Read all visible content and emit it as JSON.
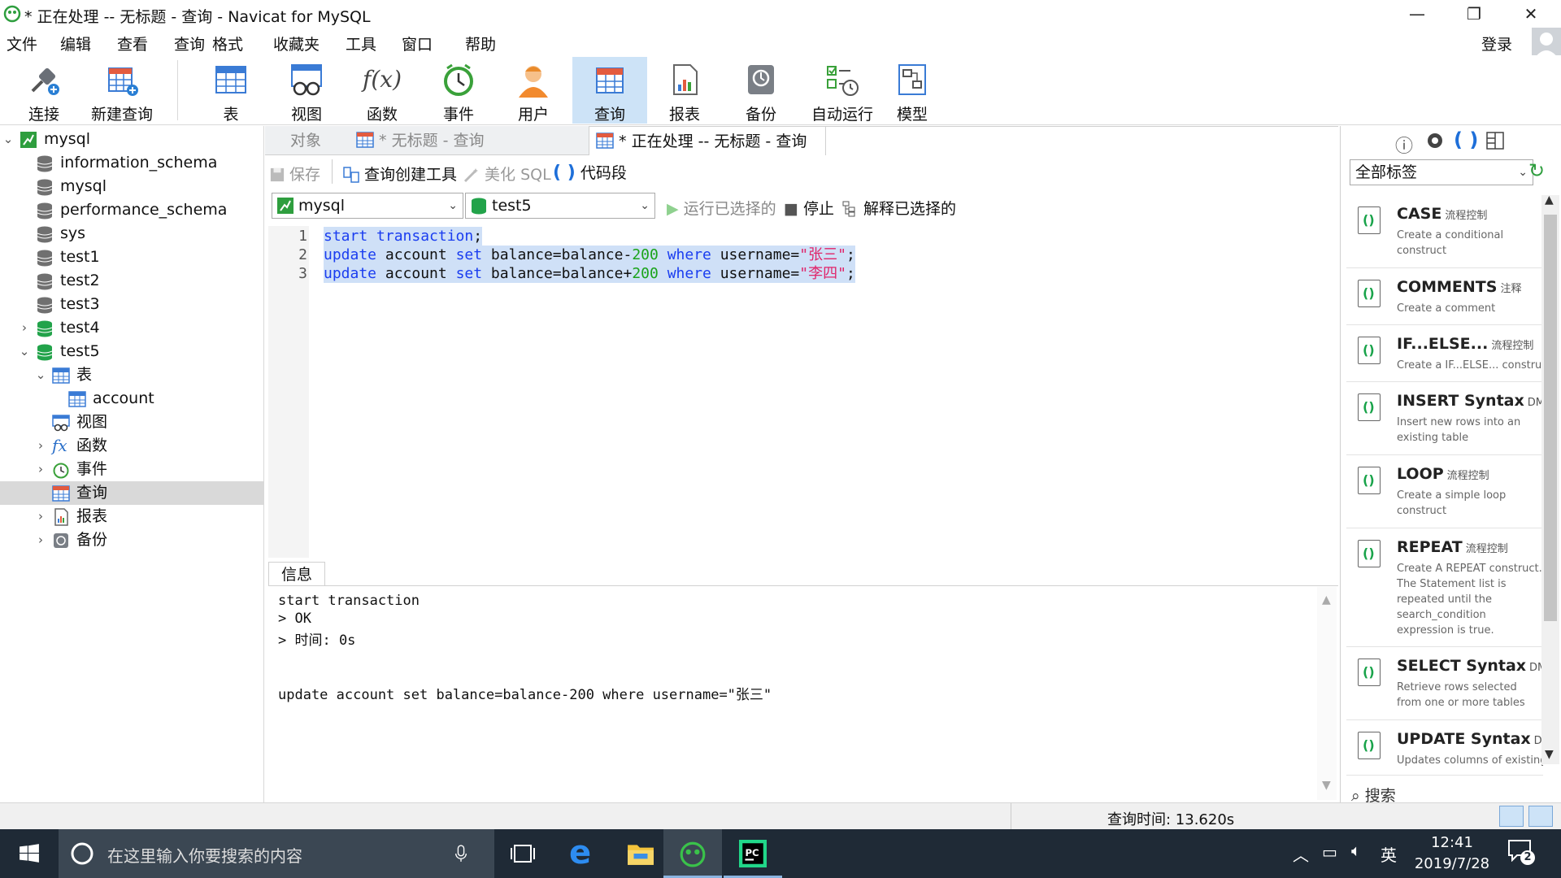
{
  "window": {
    "title": "* 正在处理 -- 无标题 - 查询 - Navicat for MySQL",
    "minimize": "—",
    "maximize": "❐",
    "close": "✕"
  },
  "menu": {
    "items": [
      "文件",
      "编辑",
      "查看",
      "查询",
      "格式",
      "收藏夹",
      "工具",
      "窗口",
      "帮助"
    ],
    "login": "登录"
  },
  "toolbar": {
    "items": [
      {
        "label": "连接",
        "icon": "connection-icon"
      },
      {
        "label": "新建查询",
        "icon": "new-query-icon"
      },
      {
        "label": "表",
        "icon": "table-icon"
      },
      {
        "label": "视图",
        "icon": "view-icon"
      },
      {
        "label": "函数",
        "icon": "function-icon"
      },
      {
        "label": "事件",
        "icon": "event-clock-icon"
      },
      {
        "label": "用户",
        "icon": "user-icon"
      },
      {
        "label": "查询",
        "icon": "query-icon"
      },
      {
        "label": "报表",
        "icon": "report-icon"
      },
      {
        "label": "备份",
        "icon": "backup-icon"
      },
      {
        "label": "自动运行",
        "icon": "autorun-icon"
      },
      {
        "label": "模型",
        "icon": "model-icon"
      }
    ],
    "function_glyph": "f(x)",
    "accent": "#cde3f7"
  },
  "tree": [
    {
      "label": "mysql",
      "level": 0,
      "expanded": true,
      "icon": "connection-icon"
    },
    {
      "label": "information_schema",
      "level": 1,
      "icon": "database-icon"
    },
    {
      "label": "mysql",
      "level": 1,
      "icon": "database-icon"
    },
    {
      "label": "performance_schema",
      "level": 1,
      "icon": "database-icon"
    },
    {
      "label": "sys",
      "level": 1,
      "icon": "database-icon"
    },
    {
      "label": "test1",
      "level": 1,
      "icon": "database-icon"
    },
    {
      "label": "test2",
      "level": 1,
      "icon": "database-icon"
    },
    {
      "label": "test3",
      "level": 1,
      "icon": "database-icon"
    },
    {
      "label": "test4",
      "level": 1,
      "icon": "database-green-icon",
      "collapsed": true
    },
    {
      "label": "test5",
      "level": 1,
      "icon": "database-green-icon",
      "expanded": true
    },
    {
      "label": "表",
      "level": 2,
      "icon": "table-icon",
      "expanded": true
    },
    {
      "label": "account",
      "level": 3,
      "icon": "table-icon"
    },
    {
      "label": "视图",
      "level": 2,
      "icon": "view-icon"
    },
    {
      "label": "函数",
      "level": 2,
      "icon": "function-icon",
      "collapsed": true
    },
    {
      "label": "事件",
      "level": 2,
      "icon": "event-clock-icon",
      "collapsed": true
    },
    {
      "label": "查询",
      "level": 2,
      "icon": "query-icon",
      "selected": true
    },
    {
      "label": "报表",
      "level": 2,
      "icon": "report-icon",
      "collapsed": true
    },
    {
      "label": "备份",
      "level": 2,
      "icon": "backup-icon",
      "collapsed": true
    }
  ],
  "tabs": [
    {
      "label": "对象"
    },
    {
      "label": "* 无标题 - 查询"
    },
    {
      "label": "* 正在处理 -- 无标题 - 查询",
      "active": true
    }
  ],
  "subtoolbar": {
    "save": "保存",
    "query_builder": "查询创建工具",
    "beautify": "美化 SQL",
    "snippet": "代码段"
  },
  "dbbar": {
    "connection": "mysql",
    "database": "test5",
    "run_selected": "运行已选择的",
    "stop": "停止",
    "explain": "解释已选择的"
  },
  "editor": {
    "line_numbers": [
      "1",
      "2",
      "3"
    ],
    "lines": [
      [
        {
          "t": "start transaction",
          "c": "kw"
        },
        {
          "t": ";",
          "c": ""
        }
      ],
      [
        {
          "t": "update",
          "c": "kw"
        },
        {
          "t": " account ",
          "c": ""
        },
        {
          "t": "set",
          "c": "kw"
        },
        {
          "t": " balance=balance-",
          "c": ""
        },
        {
          "t": "200",
          "c": "num"
        },
        {
          "t": " ",
          "c": ""
        },
        {
          "t": "where",
          "c": "kw"
        },
        {
          "t": " username=",
          "c": ""
        },
        {
          "t": "\"张三\"",
          "c": "str"
        },
        {
          "t": ";",
          "c": ""
        }
      ],
      [
        {
          "t": "update",
          "c": "kw"
        },
        {
          "t": " account ",
          "c": ""
        },
        {
          "t": "set",
          "c": "kw"
        },
        {
          "t": " balance=balance+",
          "c": ""
        },
        {
          "t": "200",
          "c": "num"
        },
        {
          "t": " ",
          "c": ""
        },
        {
          "t": "where",
          "c": "kw"
        },
        {
          "t": " username=",
          "c": ""
        },
        {
          "t": "\"李四\"",
          "c": "str"
        },
        {
          "t": ";",
          "c": ""
        }
      ]
    ]
  },
  "info": {
    "tab": "信息",
    "lines": [
      "start transaction",
      "> OK",
      "> 时间: 0s",
      "",
      "",
      "update account set balance=balance-200 where username=\"张三\""
    ]
  },
  "snippets": {
    "filter": "全部标签",
    "items": [
      {
        "title": "CASE",
        "tag": "流程控制",
        "desc": "Create a conditional construct"
      },
      {
        "title": "COMMENTS",
        "tag": "注释",
        "desc": "Create a comment"
      },
      {
        "title": "IF...ELSE...",
        "tag": "流程控制",
        "desc": "Create a IF...ELSE... construct"
      },
      {
        "title": "INSERT Syntax",
        "tag": "DML",
        "desc": "Insert new rows into an existing table"
      },
      {
        "title": "LOOP",
        "tag": "流程控制",
        "desc": "Create a simple loop construct"
      },
      {
        "title": "REPEAT",
        "tag": "流程控制",
        "desc": "Create A REPEAT construct. The Statement list is repeated until the search_condition expression is true."
      },
      {
        "title": "SELECT Syntax",
        "tag": "DML",
        "desc": "Retrieve rows selected from one or more tables"
      },
      {
        "title": "UPDATE Syntax",
        "tag": "DML",
        "desc": "Updates columns of existing"
      }
    ],
    "search": "搜索"
  },
  "status": {
    "query_time": "查询时间: 13.620s"
  },
  "taskbar": {
    "search_placeholder": "在这里输入你要搜索的内容",
    "time": "12:41",
    "date": "2019/7/28",
    "ime": "英",
    "notifications": "2"
  }
}
